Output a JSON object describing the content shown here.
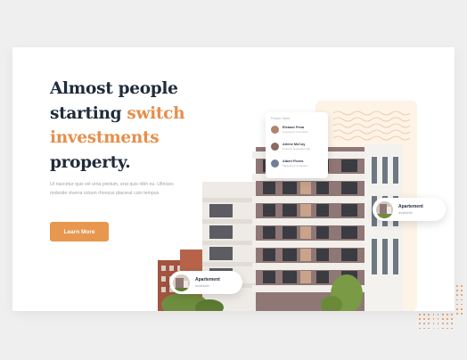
{
  "hero": {
    "headline": {
      "line1": "Almost people",
      "line2_plain": "starting ",
      "line2_accent": "switch",
      "line3": "investments",
      "line4": "property."
    },
    "paragraph": "Ut nascetur quis vel urna pretium, erat quis nibh eu. Ultricies molestie viverra rutrum rhoncus placerat cum tempus",
    "cta_label": "Learn More"
  },
  "people_card": {
    "title": "People Saver",
    "people": [
      {
        "name": "Eleanor Pena",
        "role": "Investment Consultant"
      },
      {
        "name": "Arlene McCoy",
        "role": "Property Acquisition Mgr"
      },
      {
        "name": "Albert Flores",
        "role": "Marketing Coordinator"
      }
    ]
  },
  "apartment_cards": [
    {
      "title": "Apartement",
      "status": "available"
    },
    {
      "title": "Apartement",
      "status": "available"
    }
  ],
  "colors": {
    "accent": "#e8974f",
    "heading": "#1f2b3a",
    "muted": "#9da3ab",
    "peach_bg": "#fdf3e6",
    "page_bg": "#efefef"
  }
}
